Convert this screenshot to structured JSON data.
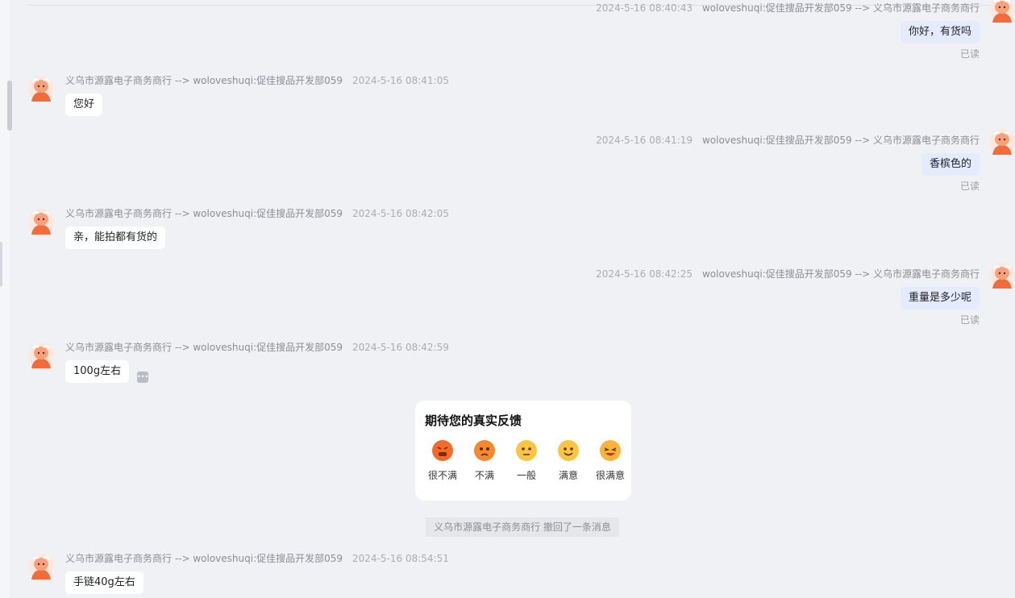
{
  "messages": [
    {
      "side": "right",
      "timestamp": "2024-5-16 08:40:43",
      "route": "woloveshuqi:促佳搜品开发部059 --> 义乌市源露电子商务商行",
      "text": "你好，有货吗",
      "status": "已读"
    },
    {
      "side": "left",
      "route": "义乌市源露电子商务商行 --> woloveshuqi:促佳搜品开发部059",
      "timestamp": "2024-5-16 08:41:05",
      "text": "您好"
    },
    {
      "side": "right",
      "timestamp": "2024-5-16 08:41:19",
      "route": "woloveshuqi:促佳搜品开发部059 --> 义乌市源露电子商务商行",
      "text": "香槟色的",
      "status": "已读"
    },
    {
      "side": "left",
      "route": "义乌市源露电子商务商行 --> woloveshuqi:促佳搜品开发部059",
      "timestamp": "2024-5-16 08:42:05",
      "text": "亲，能拍都有货的"
    },
    {
      "side": "right",
      "timestamp": "2024-5-16 08:42:25",
      "route": "woloveshuqi:促佳搜品开发部059 --> 义乌市源露电子商务商行",
      "text": "重量是多少呢",
      "status": "已读"
    },
    {
      "side": "left",
      "route": "义乌市源露电子商务商行 --> woloveshuqi:促佳搜品开发部059",
      "timestamp": "2024-5-16 08:42:59",
      "text": "100g左右"
    },
    {
      "side": "left",
      "route": "义乌市源露电子商务商行 --> woloveshuqi:促佳搜品开发部059",
      "timestamp": "2024-5-16 08:54:51",
      "text": "手链40g左右"
    }
  ],
  "feedback": {
    "title": "期待您的真实反馈",
    "options": [
      {
        "label": "很不满",
        "icon": "very-dissatisfied-face-icon",
        "color": "#f36b2b"
      },
      {
        "label": "不满",
        "icon": "dissatisfied-face-icon",
        "color": "#f5892d"
      },
      {
        "label": "一般",
        "icon": "neutral-face-icon",
        "color": "#fbc445"
      },
      {
        "label": "满意",
        "icon": "satisfied-face-icon",
        "color": "#fbc445"
      },
      {
        "label": "很满意",
        "icon": "very-satisfied-face-icon",
        "color": "#fbb43a"
      }
    ]
  },
  "recall_notice": "义乌市源露电子商务商行 撤回了一条消息",
  "colors": {
    "background": "#f0f1f5",
    "incoming_bubble": "#ffffff",
    "outgoing_bubble": "#e3ebfd",
    "avatar_orange": "#f26b3a"
  }
}
